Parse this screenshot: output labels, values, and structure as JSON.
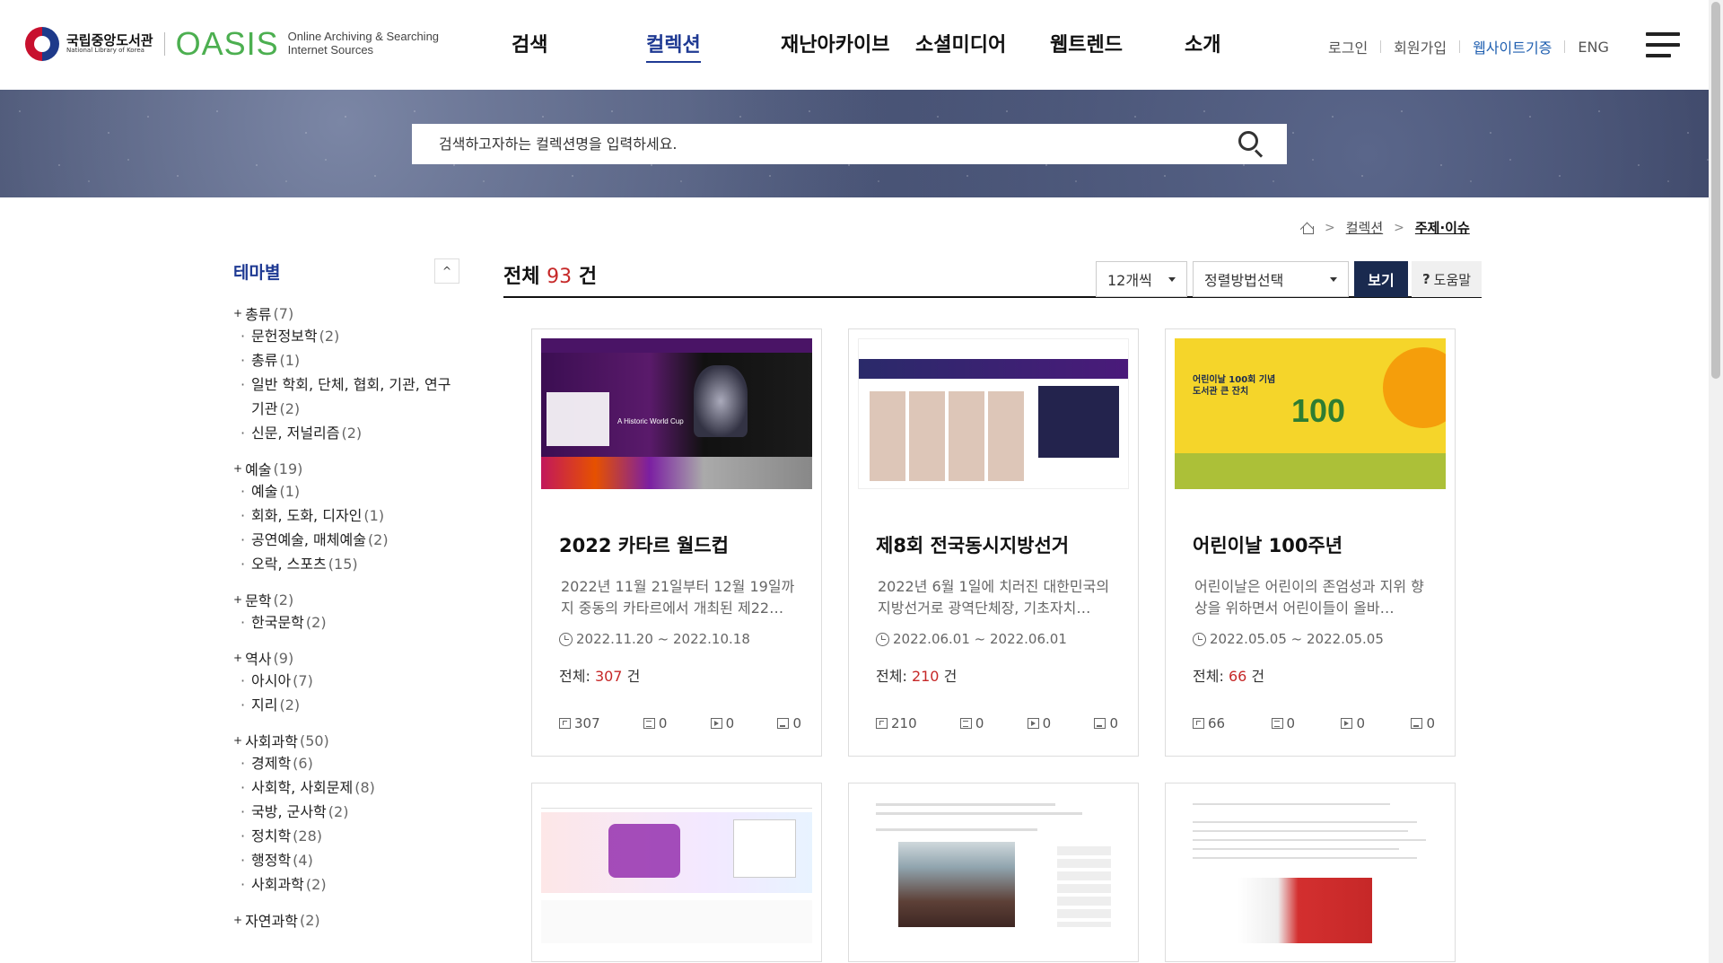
{
  "header": {
    "logo_ko": "국립중앙도서관",
    "logo_en": "National Library of Korea",
    "oasis": "OASIS",
    "oasis_sub_1": "Online Archiving & Searching",
    "oasis_sub_2": "Internet Sources",
    "nav": [
      "검색",
      "컬렉션",
      "재난아카이브",
      "소셜미디어",
      "웹트렌드",
      "소개"
    ],
    "active_nav": "컬렉션",
    "util": [
      "로그인",
      "회원가입",
      "웹사이트기증",
      "ENG"
    ],
    "accent_color": "#1f3a93"
  },
  "search": {
    "placeholder": "검색하고자하는 컬렉션명을 입력하세요."
  },
  "breadcrumb": [
    "컬렉션",
    "주제·이슈"
  ],
  "sidebar": {
    "title": "테마별",
    "categories": [
      {
        "label": "총류",
        "count": "(7)",
        "items": [
          {
            "label": "문헌정보학",
            "count": "(2)"
          },
          {
            "label": "총류",
            "count": "(1)"
          },
          {
            "label": "일반 학회, 단체, 협회, 기관, 연구기관",
            "count": "(2)"
          },
          {
            "label": "신문, 저널리즘",
            "count": "(2)"
          }
        ]
      },
      {
        "label": "예술",
        "count": "(19)",
        "items": [
          {
            "label": "예술",
            "count": "(1)"
          },
          {
            "label": "회화, 도화, 디자인",
            "count": "(1)"
          },
          {
            "label": "공연예술, 매체예술",
            "count": "(2)"
          },
          {
            "label": "오락, 스포츠",
            "count": "(15)"
          }
        ]
      },
      {
        "label": "문학",
        "count": "(2)",
        "items": [
          {
            "label": "한국문학",
            "count": "(2)"
          }
        ]
      },
      {
        "label": "역사",
        "count": "(9)",
        "items": [
          {
            "label": "아시아",
            "count": "(7)"
          },
          {
            "label": "지리",
            "count": "(2)"
          }
        ]
      },
      {
        "label": "사회과학",
        "count": "(50)",
        "items": [
          {
            "label": "경제학",
            "count": "(6)"
          },
          {
            "label": "사회학, 사회문제",
            "count": "(8)"
          },
          {
            "label": "국방, 군사학",
            "count": "(2)"
          },
          {
            "label": "정치학",
            "count": "(28)"
          },
          {
            "label": "행정학",
            "count": "(4)"
          },
          {
            "label": "사회과학",
            "count": "(2)"
          }
        ]
      },
      {
        "label": "자연과학",
        "count": "(2)",
        "items": []
      }
    ]
  },
  "main": {
    "total_label": "전체",
    "total_count": "93",
    "total_unit": "건",
    "per_page": "12개씩",
    "sort": "정렬방법선택",
    "view_btn": "보기",
    "help_btn": "도움말"
  },
  "cards": [
    {
      "title": "2022 카타르 월드컵",
      "desc": "2022년 11월 21일부터 12월 19일까지 중동의 카타르에서 개최된 제22…",
      "date": "2022.11.20 ~ 2022.10.18",
      "total_label": "전체:",
      "total": "307",
      "unit": "건",
      "stats": [
        "307",
        "0",
        "0",
        "0"
      ]
    },
    {
      "title": "제8회 전국동시지방선거",
      "desc": "2022년 6월 1일에 치러진 대한민국의 지방선거로 광역단체장, 기초자치…",
      "date": "2022.06.01 ~ 2022.06.01",
      "total_label": "전체:",
      "total": "210",
      "unit": "건",
      "stats": [
        "210",
        "0",
        "0",
        "0"
      ]
    },
    {
      "title": "어린이날 100주년",
      "desc": "어린이날은 어린이의 존엄성과 지위 향상을 위하면서 어린이들이 올바…",
      "date": "2022.05.05 ~ 2022.05.05",
      "total_label": "전체:",
      "total": "66",
      "unit": "건",
      "stats": [
        "66",
        "0",
        "0",
        "0"
      ]
    }
  ],
  "thumbs": {
    "wc_text": "A Historic World Cup",
    "cd_text_1": "어린이날 100회 기념",
    "cd_text_2": "도서관 큰 잔치",
    "cd_num": "100"
  }
}
